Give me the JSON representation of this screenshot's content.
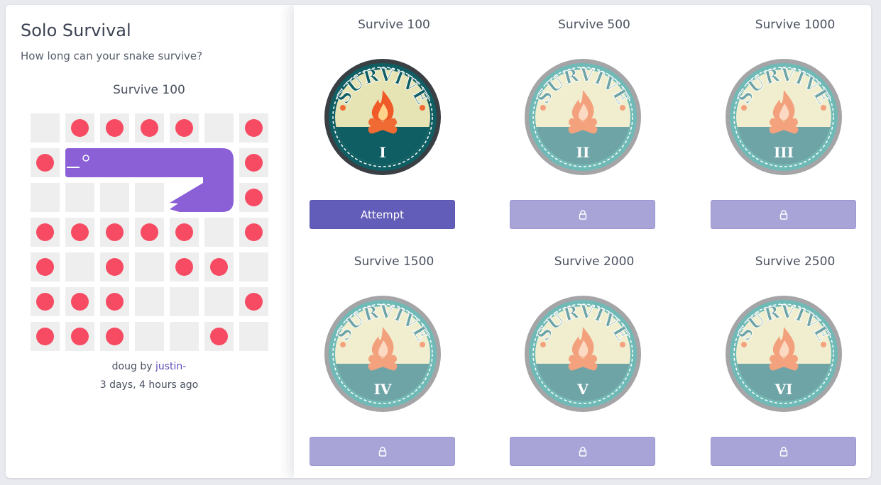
{
  "panel": {
    "title": "Solo Survival",
    "subtitle": "How long can your snake survive?"
  },
  "replay": {
    "board_title": "Survive 100",
    "snake_name": "doug",
    "by_text": "by",
    "author": "justin-",
    "time_ago": "3 days, 4 hours ago",
    "board": {
      "rows": 7,
      "cols": 7,
      "food": [
        [
          0,
          1
        ],
        [
          0,
          2
        ],
        [
          0,
          3
        ],
        [
          0,
          4
        ],
        [
          0,
          6
        ],
        [
          1,
          0
        ],
        [
          1,
          6
        ],
        [
          2,
          6
        ],
        [
          3,
          0
        ],
        [
          3,
          1
        ],
        [
          3,
          2
        ],
        [
          3,
          3
        ],
        [
          3,
          4
        ],
        [
          3,
          6
        ],
        [
          4,
          0
        ],
        [
          4,
          2
        ],
        [
          4,
          4
        ],
        [
          4,
          5
        ],
        [
          5,
          0
        ],
        [
          5,
          1
        ],
        [
          5,
          2
        ],
        [
          5,
          6
        ],
        [
          6,
          0
        ],
        [
          6,
          1
        ],
        [
          6,
          2
        ],
        [
          6,
          5
        ]
      ],
      "snake": [
        [
          1,
          1
        ],
        [
          1,
          2
        ],
        [
          1,
          3
        ],
        [
          1,
          4
        ],
        [
          1,
          5
        ],
        [
          2,
          5
        ],
        [
          2,
          4
        ]
      ],
      "snake_color": "#8b5fd6",
      "food_color": "#f64b62",
      "cell_color": "#eeeeee"
    }
  },
  "challenges": [
    {
      "title": "Survive 100",
      "badge_text": "SURVIVE",
      "numeral": "I",
      "status": "unlocked",
      "button_label": "Attempt",
      "button_icon": "lock-icon"
    },
    {
      "title": "Survive 500",
      "badge_text": "SURVIVE",
      "numeral": "II",
      "status": "locked",
      "button_label": "",
      "button_icon": "lock-icon"
    },
    {
      "title": "Survive 1000",
      "badge_text": "SURVIVE",
      "numeral": "III",
      "status": "locked",
      "button_label": "",
      "button_icon": "lock-icon"
    },
    {
      "title": "Survive 1500",
      "badge_text": "SURVIVE",
      "numeral": "IV",
      "status": "locked",
      "button_label": "",
      "button_icon": "lock-icon"
    },
    {
      "title": "Survive 2000",
      "badge_text": "SURVIVE",
      "numeral": "V",
      "status": "locked",
      "button_label": "",
      "button_icon": "lock-icon"
    },
    {
      "title": "Survive 2500",
      "badge_text": "SURVIVE",
      "numeral": "VI",
      "status": "locked",
      "button_label": "",
      "button_icon": "lock-icon"
    }
  ],
  "colors": {
    "accent": "#625db8",
    "locked_button": "#a8a4d8",
    "badge_active_ring": "#0f5e63",
    "badge_locked_ring": "#6fbab6"
  }
}
